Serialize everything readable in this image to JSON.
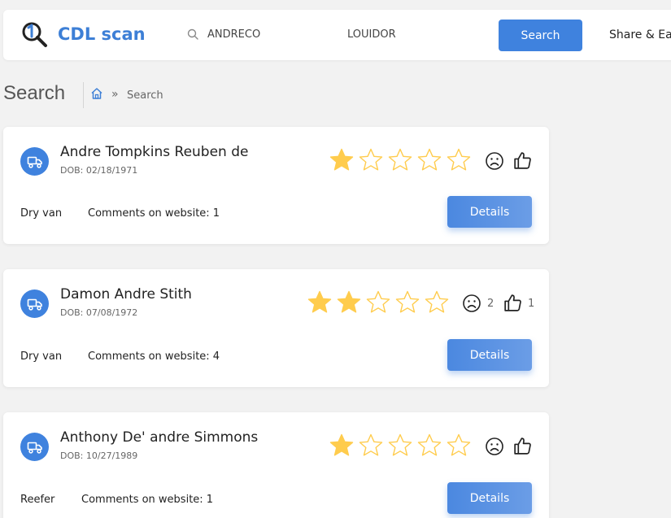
{
  "header": {
    "brand": "CDL scan",
    "first_name": "ANDRECO",
    "last_name": "LOUIDOR",
    "search_label": "Search",
    "share_label": "Share & Earn"
  },
  "page": {
    "title": "Search",
    "breadcrumb_sep": "»",
    "breadcrumb_current": "Search"
  },
  "colors": {
    "accent": "#3f82de",
    "star": "#ffcc4d",
    "background": "#f2f2f2"
  },
  "results": [
    {
      "name": "Andre Tompkins Reuben de",
      "dob": "DOB: 02/18/1971",
      "rating": 1,
      "negative_count": "",
      "positive_count": "",
      "trailer": "Dry van",
      "comments": "Comments on website: 1",
      "details_label": "Details"
    },
    {
      "name": "Damon Andre Stith",
      "dob": "DOB: 07/08/1972",
      "rating": 2,
      "negative_count": "2",
      "positive_count": "1",
      "trailer": "Dry van",
      "comments": "Comments on website: 4",
      "details_label": "Details"
    },
    {
      "name": "Anthony De' andre Simmons",
      "dob": "DOB: 10/27/1989",
      "rating": 1,
      "negative_count": "",
      "positive_count": "",
      "trailer": "Reefer",
      "comments": "Comments on website: 1",
      "details_label": "Details"
    }
  ]
}
